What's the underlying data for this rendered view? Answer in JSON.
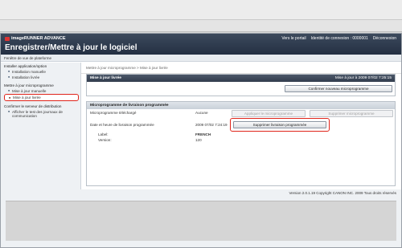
{
  "browser": {
    "dropdown_glyph": "▼"
  },
  "header": {
    "brand": "imageRUNNER ADVANCE",
    "portal_link": "Vers le portail",
    "login_id": "Identité de connexion : 0000001",
    "logout": "Déconnexion",
    "title": "Enregistrer/Mettre à jour le logiciel"
  },
  "breadcrumb_top": "Fenêtre de vue de plateforme",
  "sidebar": {
    "groups": [
      {
        "label": "Installer application/option",
        "items": [
          "Installation manuelle",
          "Installation livrée"
        ]
      },
      {
        "label": "Mettre à jour microprogramme",
        "items": [
          "Mise à jour manuelle",
          "Mise à jour livrée"
        ]
      },
      {
        "label": "Confirmer le serveur de distribution",
        "items": [
          "Afficher le test des journaux de communication"
        ]
      }
    ],
    "selected": "Mise à jour livrée"
  },
  "main": {
    "breadcrumb": "Mettre à jour microprogramme > Mise à jour livrée",
    "update_panel": {
      "title": "Mise à jour livrée",
      "last_update": "Mise à jour à 2009 07/02 7:25:15",
      "confirm_button": "Confirmer nouveau microprogramme"
    },
    "firmware_panel": {
      "title": "Microprogramme de livraison programmée",
      "rows": [
        {
          "label": "Microprogramme téléchargé",
          "value": "Aucune"
        },
        {
          "label": "Date et heure de livraison programmée",
          "value": "2009 07/02 7:24:19"
        },
        {
          "label": "Label:",
          "value": "FRENCH"
        },
        {
          "label": "Version:",
          "value": "120"
        }
      ],
      "apply_button": "Appliquer le microprogramme",
      "delete_firmware_button": "Supprimer microprogramme",
      "delete_schedule_button": "Supprimer livraison programmée"
    }
  },
  "footer": {
    "version": "Version 2.0.1.19 Copyright CANON INC. 2009 Tous droits réservés"
  }
}
